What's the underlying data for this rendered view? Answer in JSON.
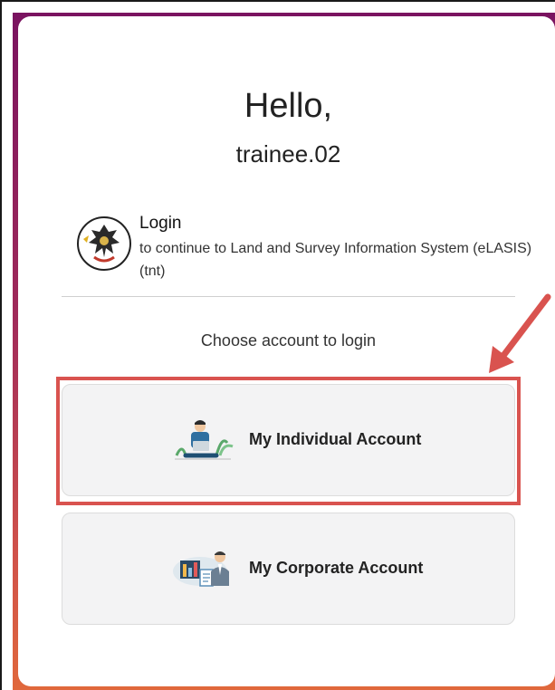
{
  "greeting": "Hello,",
  "username": "trainee.02",
  "login": {
    "title": "Login",
    "description": "to continue to Land and Survey Information System (eLASIS) (tnt)"
  },
  "prompt": "Choose account to login",
  "accounts": [
    {
      "label": "My Individual Account",
      "icon": "person-laptop-icon"
    },
    {
      "label": "My Corporate Account",
      "icon": "business-person-icon"
    }
  ],
  "colors": {
    "highlight": "#d9534f",
    "arrow": "#d9534f",
    "gradient_top": "#7a1360",
    "gradient_bottom": "#e0683c"
  }
}
